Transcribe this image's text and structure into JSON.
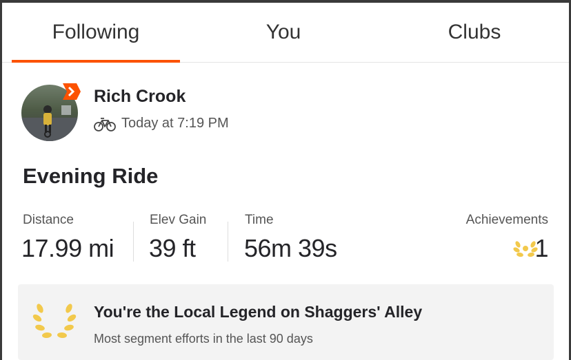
{
  "tabs": [
    {
      "label": "Following",
      "active": true
    },
    {
      "label": "You",
      "active": false
    },
    {
      "label": "Clubs",
      "active": false
    }
  ],
  "accent_color": "#fc5200",
  "athlete": {
    "name": "Rich Crook",
    "activity_type_icon": "bike-icon",
    "timestamp": "Today at 7:19 PM"
  },
  "activity": {
    "title": "Evening Ride",
    "stats": [
      {
        "label": "Distance",
        "value": "17.99 mi"
      },
      {
        "label": "Elev Gain",
        "value": "39 ft"
      },
      {
        "label": "Time",
        "value": "56m 39s"
      }
    ],
    "achievements": {
      "label": "Achievements",
      "count": "1",
      "icon": "laurel-icon"
    }
  },
  "legend": {
    "icon": "laurel-icon",
    "title": "You're the Local Legend on Shaggers' Alley",
    "subtitle": "Most segment efforts in the last 90 days",
    "icon_color": "#f2c94c"
  }
}
